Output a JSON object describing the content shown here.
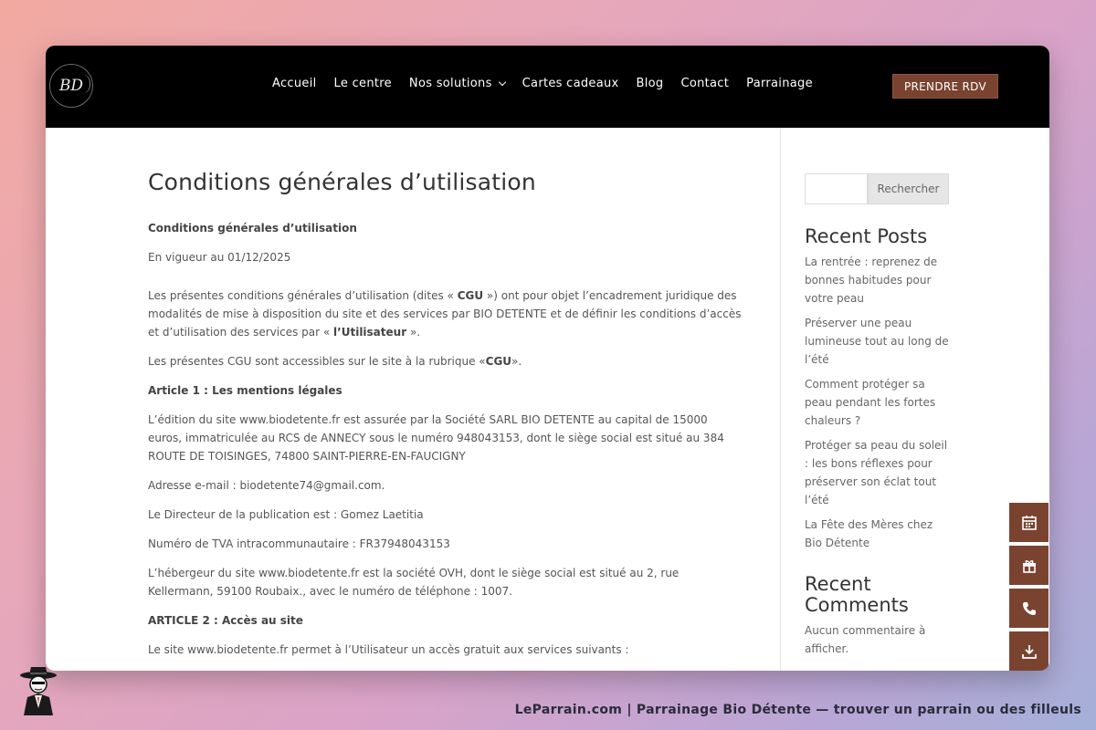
{
  "header": {
    "logo_text": "BD",
    "nav": [
      {
        "label": "Accueil"
      },
      {
        "label": "Le centre"
      },
      {
        "label": "Nos solutions",
        "has_dropdown": true
      },
      {
        "label": "Cartes cadeaux"
      },
      {
        "label": "Blog"
      },
      {
        "label": "Contact"
      },
      {
        "label": "Parrainage"
      }
    ],
    "cta_label": "PRENDRE RDV"
  },
  "main": {
    "title": "Conditions générales d’utilisation",
    "subtitle": "Conditions générales d’utilisation",
    "effective_date": "En vigueur au 01/12/2025",
    "intro_1": "Les présentes conditions générales d’utilisation (dites « ",
    "intro_cgu": "CGU",
    "intro_2": " ») ont pour objet l’encadrement juridique des modalités de mise à disposition du site et des services par BIO DETENTE  et de définir les conditions d’accès et d’utilisation des services par « ",
    "intro_user": "l’Utilisateur",
    "intro_3": " ».",
    "access_1": "Les présentes CGU sont accessibles sur le site à la rubrique «",
    "access_cgu": "CGU",
    "access_2": "».",
    "article1_title": "Article 1 : Les mentions légales",
    "article1_edition": "L’édition du site www.biodetente.fr est assurée par la Société SARL BIO DETENTE au capital de 15000 euros, immatriculée au RCS de ANNECY sous le numéro 948043153, dont le siège social est situé au 384 ROUTE DE TOISINGES, 74800 SAINT-PIERRE-EN-FAUCIGNY",
    "article1_email": "Adresse e-mail : biodetente74@gmail.com.",
    "article1_director": "Le Directeur de la publication est : Gomez Laetitia",
    "article1_tva": "Numéro de TVA intracommunautaire : FR37948043153",
    "article1_host": "L’hébergeur du site www.biodetente.fr est la société OVH, dont le siège social est situé au 2, rue Kellermann, 59100 Roubaix., avec le numéro de téléphone : 1007.",
    "article2_title": "ARTICLE 2 : Accès au site",
    "article2_text": "Le site www.biodetente.fr  permet à l’Utilisateur un accès gratuit aux services suivants :"
  },
  "sidebar": {
    "search_placeholder": "",
    "search_button": "Rechercher",
    "recent_posts_title": "Recent Posts",
    "posts": [
      "La rentrée : reprenez de bonnes habitudes pour votre peau",
      "Préserver une peau lumineuse tout au long de l’été",
      "Comment protéger sa peau pendant les fortes chaleurs ?",
      "Protéger sa peau du soleil : les bons réflexes pour préserver son éclat tout l’été",
      "La Fête des Mères chez Bio Détente"
    ],
    "recent_comments_title": "Recent Comments",
    "no_comments": "Aucun commentaire à afficher."
  },
  "floating_buttons": [
    "calendar-icon",
    "gift-icon",
    "phone-icon",
    "download-icon"
  ],
  "colors": {
    "accent": "#7a4330",
    "header_bg": "#000000"
  },
  "footer": {
    "caption": "LeParrain.com | Parrainage Bio Détente — trouver un parrain ou des filleuls"
  }
}
